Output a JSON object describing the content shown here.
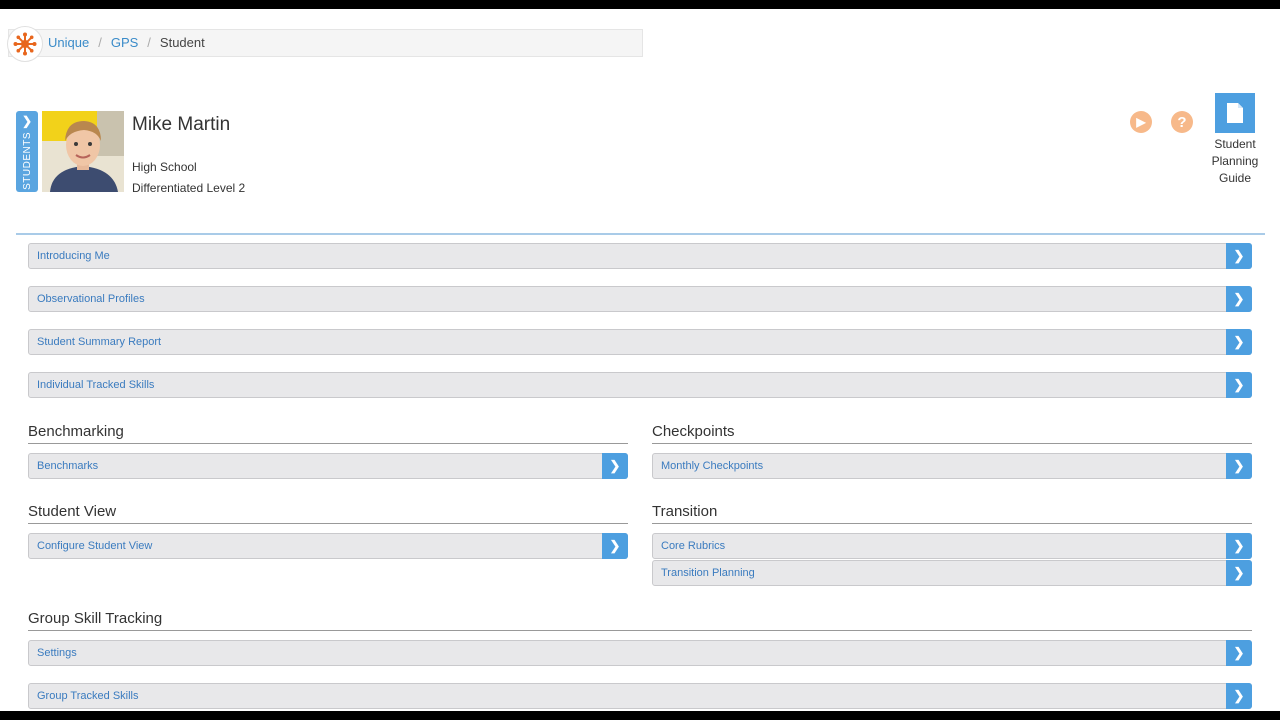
{
  "breadcrumb": {
    "items": [
      "Unique",
      "GPS"
    ],
    "current": "Student",
    "separator": "/"
  },
  "student": {
    "tab_label": "STUDENTS",
    "name": "Mike Martin",
    "school": "High School",
    "level": "Differentiated Level 2"
  },
  "guide": {
    "line1": "Student",
    "line2": "Planning",
    "line3": "Guide"
  },
  "top_links": [
    {
      "label": "Introducing Me"
    },
    {
      "label": "Observational Profiles"
    },
    {
      "label": "Student Summary Report"
    },
    {
      "label": "Individual Tracked Skills"
    }
  ],
  "sections": {
    "benchmarking": {
      "title": "Benchmarking",
      "items": [
        {
          "label": "Benchmarks"
        }
      ]
    },
    "checkpoints": {
      "title": "Checkpoints",
      "items": [
        {
          "label": "Monthly Checkpoints"
        }
      ]
    },
    "student_view": {
      "title": "Student View",
      "items": [
        {
          "label": "Configure Student View"
        }
      ]
    },
    "transition": {
      "title": "Transition",
      "items": [
        {
          "label": "Core Rubrics"
        },
        {
          "label": "Transition Planning"
        }
      ]
    },
    "group": {
      "title": "Group Skill Tracking",
      "items": [
        {
          "label": "Settings"
        },
        {
          "label": "Group Tracked Skills"
        }
      ]
    }
  },
  "colors": {
    "accent": "#4d9fe0",
    "link": "#3a7bbf",
    "icon_orange": "#f7b98a",
    "logo_orange": "#e8661d"
  }
}
